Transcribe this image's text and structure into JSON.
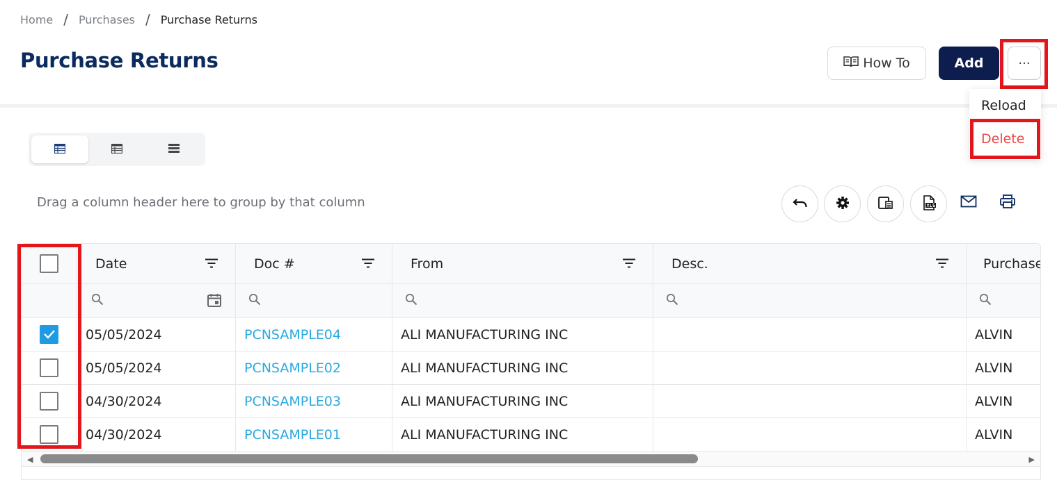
{
  "breadcrumb": {
    "home": "Home",
    "sep": "/",
    "purchases": "Purchases",
    "current": "Purchase Returns"
  },
  "page": {
    "title": "Purchase Returns"
  },
  "actions": {
    "howto_label": "How To",
    "add_label": "Add",
    "more_label": "···"
  },
  "menu": {
    "reload": "Reload",
    "delete": "Delete"
  },
  "toolbar": {
    "group_hint": "Drag a column header here to group by that column"
  },
  "grid": {
    "columns": [
      "Date",
      "Doc #",
      "From",
      "Desc.",
      "Purchase"
    ],
    "rows": [
      {
        "checked": true,
        "date": "05/05/2024",
        "doc": "PCNSAMPLE04",
        "from": "ALI MANUFACTURING INC",
        "desc": "",
        "purchaser": "ALVIN"
      },
      {
        "checked": false,
        "date": "05/05/2024",
        "doc": "PCNSAMPLE02",
        "from": "ALI MANUFACTURING INC",
        "desc": "",
        "purchaser": "ALVIN"
      },
      {
        "checked": false,
        "date": "04/30/2024",
        "doc": "PCNSAMPLE03",
        "from": "ALI MANUFACTURING INC",
        "desc": "",
        "purchaser": "ALVIN"
      },
      {
        "checked": false,
        "date": "04/30/2024",
        "doc": "PCNSAMPLE01",
        "from": "ALI MANUFACTURING INC",
        "desc": "",
        "purchaser": "ALVIN"
      }
    ]
  },
  "colors": {
    "brand": "#0b2a5e",
    "link": "#29a9e0",
    "danger": "#ef4444",
    "highlight": "#e3161b",
    "checkbox": "#1f9be3"
  },
  "icons": [
    "book-icon",
    "ellipsis-icon",
    "grid-view-icon",
    "list-view-icon",
    "compact-view-icon",
    "undo-icon",
    "gear-icon",
    "export-icon",
    "excel-icon",
    "mail-icon",
    "print-icon",
    "filter-icon",
    "search-icon",
    "calendar-icon",
    "check-icon"
  ]
}
